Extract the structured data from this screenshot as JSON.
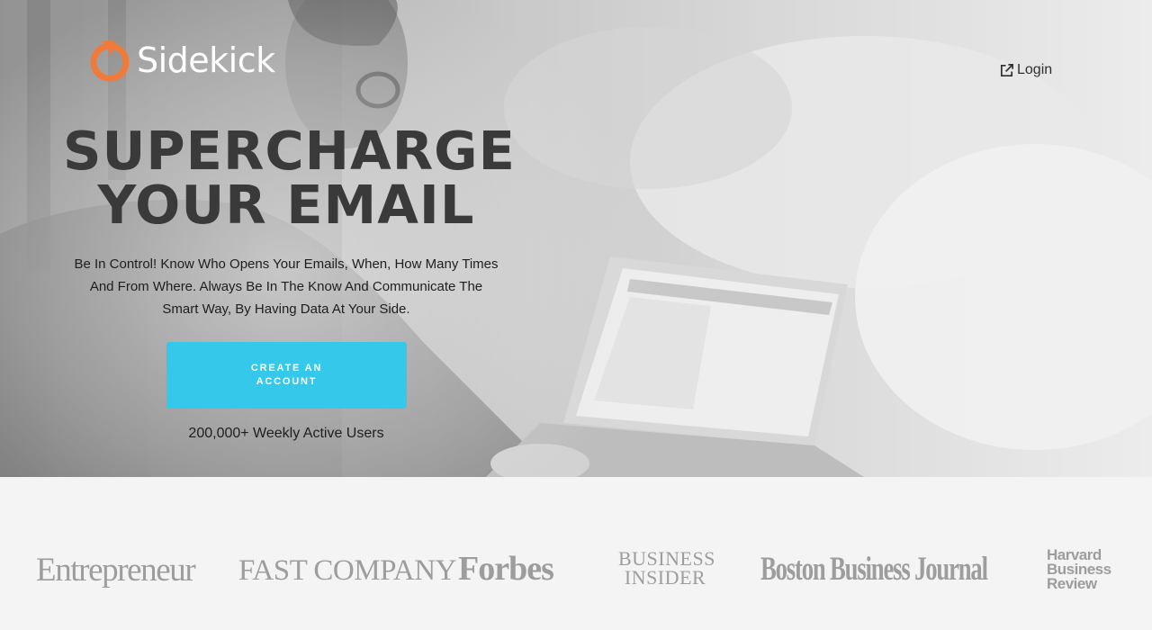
{
  "brand": {
    "name": "Sidekick",
    "accent": "#ef7b3a"
  },
  "nav": {
    "login_label": "Login",
    "login_icon": "external-link-icon"
  },
  "hero": {
    "headline_line1": "SUPERCHARGE",
    "headline_line2": "YOUR EMAIL",
    "subtext": "Be In Control! Know Who Opens Your Emails, When, How Many Times And From Where. Always Be In The Know And Communicate The Smart Way, By Having Data At Your Side.",
    "cta_label": "CREATE AN ACCOUNT",
    "cta_color": "#34c9ea",
    "users_text": "200,000+ Weekly Active Users"
  },
  "press": {
    "logos": [
      {
        "name": "Entrepreneur"
      },
      {
        "name": "FAST COMPANY",
        "display": "FAST COMPANY"
      },
      {
        "name": "Forbes"
      },
      {
        "name": "BUSINESS INSIDER",
        "line1": "BUSINESS",
        "line2": "INSIDER"
      },
      {
        "name": "Boston Business Journal"
      },
      {
        "name": "Harvard Business Review",
        "line1": "Harvard",
        "line2": "Business",
        "line3": "Review"
      }
    ]
  }
}
